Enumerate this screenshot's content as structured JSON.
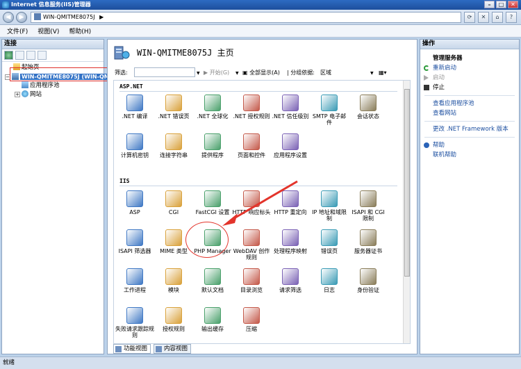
{
  "window": {
    "title": "Internet 信息服务(IIS)管理器"
  },
  "address": {
    "path": "WIN-QMITME8075J",
    "sep": "▶"
  },
  "menu": {
    "file": "文件(F)",
    "view": "视图(V)",
    "help": "帮助(H)"
  },
  "left": {
    "header": "连接",
    "tree": {
      "start": "起始页",
      "server": "WIN-QMITME8075J (WIN-QMITM",
      "apppools": "应用程序池",
      "sites": "网站"
    }
  },
  "center": {
    "title": "WIN-QMITME8075J 主页",
    "filter": {
      "label": "筛选:",
      "start": "开始(G)",
      "showall": "全部显示(A)",
      "groupby": "分组依据:",
      "groupval": "区域"
    },
    "groups": {
      "aspnet": "ASP.NET",
      "iis": "IIS"
    },
    "aspnet_tiles": [
      {
        "label": ".NET 编译",
        "icon": "dotnet-compile-icon"
      },
      {
        "label": ".NET 错误页",
        "icon": "dotnet-error-icon"
      },
      {
        "label": ".NET 全球化",
        "icon": "dotnet-globe-icon"
      },
      {
        "label": ".NET 授权规则",
        "icon": "dotnet-auth-icon"
      },
      {
        "label": ".NET 信任级别",
        "icon": "dotnet-trust-icon"
      },
      {
        "label": "SMTP 电子邮件",
        "icon": "smtp-mail-icon"
      },
      {
        "label": "会话状态",
        "icon": "session-state-icon"
      },
      {
        "label": "计算机密钥",
        "icon": "machine-key-icon"
      },
      {
        "label": "连接字符串",
        "icon": "connection-string-icon"
      },
      {
        "label": "提供程序",
        "icon": "providers-icon"
      },
      {
        "label": "页面和控件",
        "icon": "pages-controls-icon"
      },
      {
        "label": "应用程序设置",
        "icon": "app-settings-icon"
      }
    ],
    "iis_tiles": [
      {
        "label": "ASP",
        "icon": "asp-icon"
      },
      {
        "label": "CGI",
        "icon": "cgi-icon"
      },
      {
        "label": "FastCGI 设置",
        "icon": "fastcgi-icon"
      },
      {
        "label": "HTTP 响应标头",
        "icon": "http-headers-icon"
      },
      {
        "label": "HTTP 重定向",
        "icon": "http-redirect-icon"
      },
      {
        "label": "IP 地址和域限制",
        "icon": "ip-restrict-icon"
      },
      {
        "label": "ISAPI 和 CGI 限制",
        "icon": "isapi-cgi-icon"
      },
      {
        "label": "ISAPI 筛选器",
        "icon": "isapi-filter-icon"
      },
      {
        "label": "MIME 类型",
        "icon": "mime-icon"
      },
      {
        "label": "PHP Manager",
        "icon": "php-manager-icon"
      },
      {
        "label": "WebDAV 创作规则",
        "icon": "webdav-icon"
      },
      {
        "label": "处理程序映射",
        "icon": "handler-map-icon"
      },
      {
        "label": "错误页",
        "icon": "error-page-icon"
      },
      {
        "label": "服务器证书",
        "icon": "certificate-icon"
      },
      {
        "label": "工作进程",
        "icon": "worker-process-icon"
      },
      {
        "label": "模块",
        "icon": "modules-icon"
      },
      {
        "label": "默认文档",
        "icon": "default-doc-icon"
      },
      {
        "label": "目录浏览",
        "icon": "dir-browse-icon"
      },
      {
        "label": "请求筛选",
        "icon": "request-filter-icon"
      },
      {
        "label": "日志",
        "icon": "logging-icon"
      },
      {
        "label": "身份验证",
        "icon": "authentication-icon"
      },
      {
        "label": "失败请求跟踪规则",
        "icon": "failed-request-icon"
      },
      {
        "label": "授权规则",
        "icon": "authorization-icon"
      },
      {
        "label": "输出缓存",
        "icon": "output-cache-icon"
      },
      {
        "label": "压缩",
        "icon": "compression-icon"
      }
    ],
    "tabs": {
      "features": "功能视图",
      "content": "内容视图"
    }
  },
  "right": {
    "header": "操作",
    "manage": "管理服务器",
    "restart": "重新启动",
    "start": "启动",
    "stop": "停止",
    "apppools": "查看应用程序池",
    "sites": "查看网站",
    "framework": "更改 .NET Framework 版本",
    "help": "帮助",
    "online": "联机帮助"
  },
  "status": {
    "text": "就绪"
  }
}
